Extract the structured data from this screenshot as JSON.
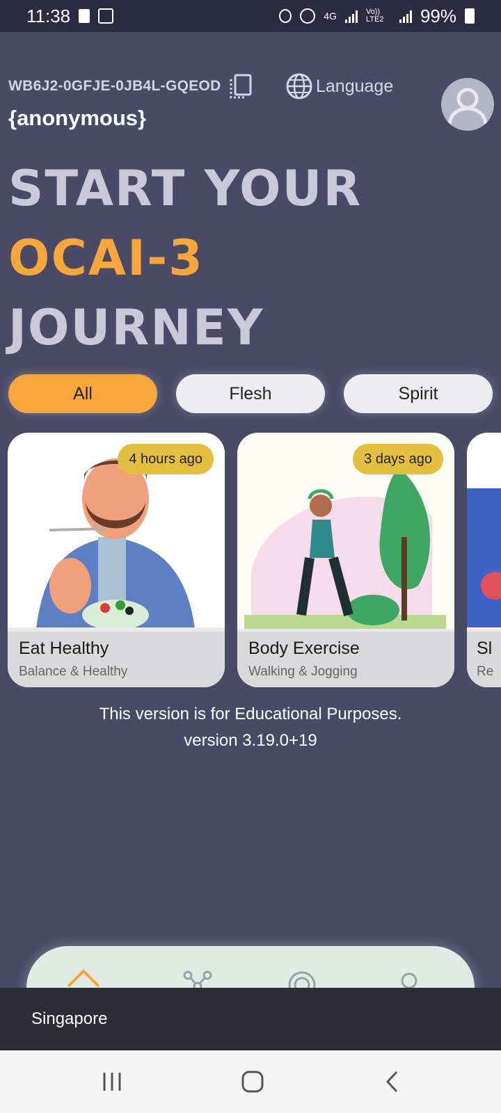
{
  "status_bar": {
    "time": "11:38",
    "network": "4G",
    "volte": "Vo)) LTE2",
    "battery": "99%"
  },
  "header": {
    "device_code": "WB6J2-0GFJE-0JB4L-GQEOD",
    "language_label": "Language",
    "username": "{anonymous}"
  },
  "headline": {
    "line1": "START YOUR",
    "line2": "OCAI-3",
    "line3": "JOURNEY"
  },
  "filters": [
    {
      "label": "All",
      "active": true
    },
    {
      "label": "Flesh",
      "active": false
    },
    {
      "label": "Spirit",
      "active": false
    }
  ],
  "cards": [
    {
      "title": "Eat Healthy",
      "subtitle": "Balance & Healthy",
      "badge": "4 hours ago"
    },
    {
      "title": "Body Exercise",
      "subtitle": "Walking & Jogging",
      "badge": "3 days ago"
    },
    {
      "title": "Sl",
      "subtitle": "Re"
    }
  ],
  "footer_notice": {
    "line1": "This version is for Educational Purposes.",
    "line2": "version 3.19.0+19"
  },
  "bottom_nav": [
    "home-icon",
    "network-icon",
    "ai-icon",
    "profile-icon"
  ],
  "toast": {
    "text": "Singapore"
  },
  "colors": {
    "background": "#4a4966",
    "accent": "#f7a63b",
    "badge": "#e3bf40",
    "chip": "#ededf0"
  }
}
